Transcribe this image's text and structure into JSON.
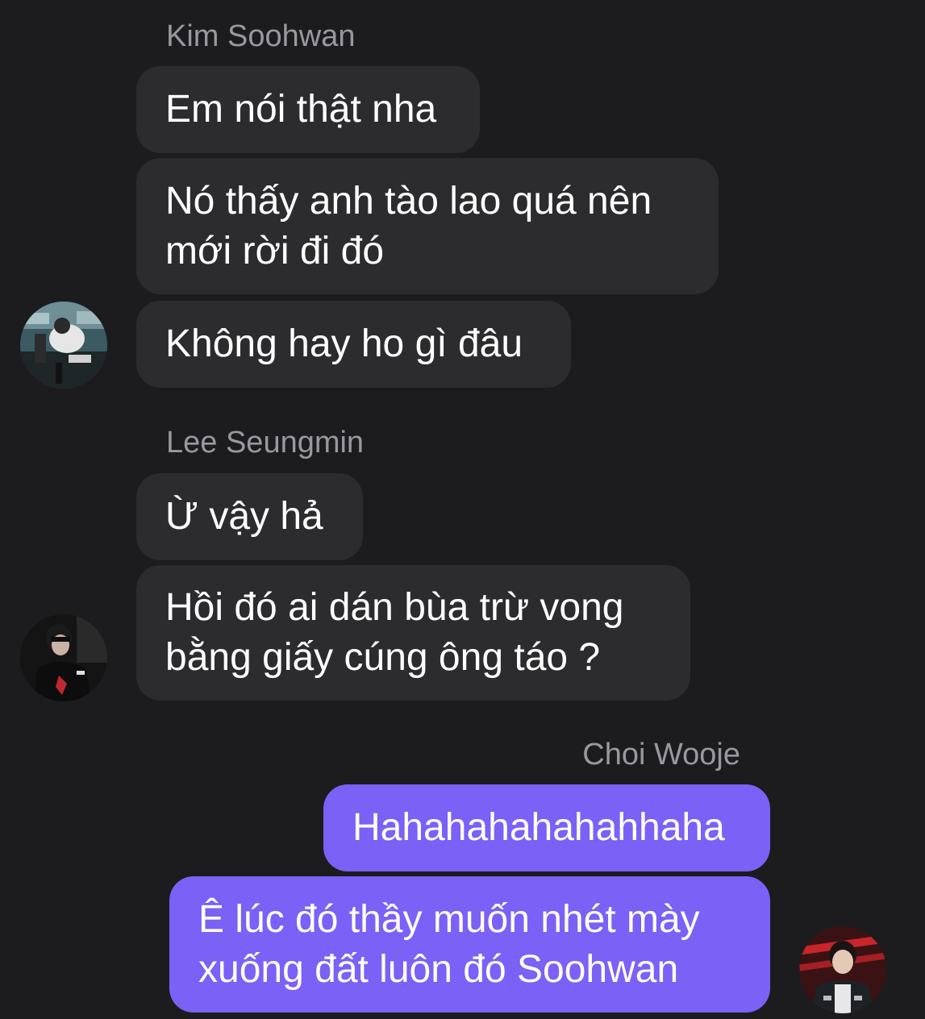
{
  "colors": {
    "background": "#1c1c1e",
    "incoming_bubble": "#2c2c2e",
    "outgoing_bubble": "#7b61f5",
    "sender_name": "#98989f",
    "message_text": "#ffffff"
  },
  "groups": [
    {
      "sender": "Kim Soohwan",
      "direction": "incoming",
      "avatar_icon": "avatar-photo-icon",
      "messages": [
        {
          "text": "Em nói thật nha"
        },
        {
          "text": "Nó thấy anh tào lao quá nên mới rời đi đó"
        },
        {
          "text": "Không hay ho gì đâu"
        }
      ]
    },
    {
      "sender": "Lee Seungmin",
      "direction": "incoming",
      "avatar_icon": "avatar-photo-icon",
      "messages": [
        {
          "text": "Ừ vậy hả"
        },
        {
          "text": "Hồi đó ai dán bùa trừ vong bằng giấy cúng ông táo ?"
        }
      ]
    },
    {
      "sender": "Choi Wooje",
      "direction": "outgoing",
      "avatar_icon": "avatar-photo-icon",
      "messages": [
        {
          "text": "Hahahahahahahhaha"
        },
        {
          "text": "Ê lúc đó thầy muốn nhét mày xuống đất luôn đó Soohwan"
        }
      ]
    }
  ]
}
